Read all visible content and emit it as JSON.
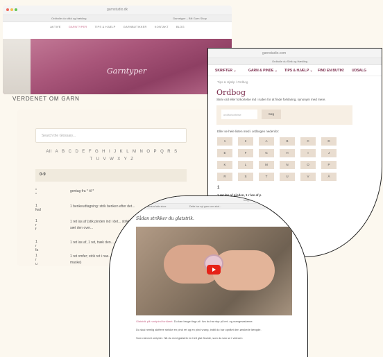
{
  "window1": {
    "url": "garnstudio.dk",
    "tabs": [
      "Ordbolle du stikk og hækling",
      "Garnstype – Blit Garn Shop"
    ],
    "nav": [
      "AKTIVE",
      "GARNTYPER",
      "TIPS & HJÆLP",
      "GARNBUTIKKER",
      "KONTAKT",
      "BLOG"
    ],
    "active_nav": "GARNTYPER",
    "hero_title": "Garntyper",
    "page_heading": "VERDENET OM GARN"
  },
  "glossary": {
    "search_placeholder": "Search the Glossary...",
    "letters_row1": [
      "All",
      "A",
      "B",
      "C",
      "D",
      "E",
      "F",
      "G",
      "H",
      "I",
      "J",
      "K",
      "L",
      "M",
      "N",
      "O",
      "P",
      "Q",
      "R",
      "S"
    ],
    "letters_row2": [
      "T",
      "U",
      "V",
      "W",
      "X",
      "Y",
      "Z"
    ],
    "section": "0-9",
    "rows": [
      {
        "term": "* *",
        "desc": "gentag fra * til *"
      },
      {
        "term": "1 fwd",
        "desc": "1 benkeudtagning: strik benken efter det..."
      },
      {
        "term": "1 r f",
        "desc": "1 ret las af (stik pinden ind i det... strikkes ret, og sæt den over..."
      },
      {
        "term": "1 r fa",
        "desc": "1 ret las af, 1 ret, træk den..."
      },
      {
        "term": "1 r u",
        "desc": "1 ret omfer; strik ret i nas... denne (= omslag + maske)"
      }
    ]
  },
  "window2": {
    "url": "garnstudio.com",
    "tab": "Ordbolle du Strik og Hækling",
    "nav": [
      "SKRIFTER ⌄",
      "GARN & PINDE ⌄",
      "TIPS & HJÆLP ⌄",
      "FIND EN BUTIK!",
      "UDSALG"
    ],
    "breadcrumb": "Tips & Hjælp  /  Ordbog",
    "title": "Ordbog",
    "lead": "Skriv ord eller forkortelse ind i ruden for at finde forklaring, synonym med mere.",
    "search_placeholder": "ord/forkortelse",
    "search_button": "Søg",
    "or_text": "Eller se hele listen med i ordbogen nedenfor:",
    "letters": [
      "1",
      "2",
      "A",
      "B",
      "C",
      "D",
      "E",
      "F",
      "G",
      "H",
      "I",
      "J",
      "K",
      "L",
      "M",
      "N",
      "O",
      "P",
      "R",
      "S",
      "T",
      "U",
      "V",
      "Å"
    ],
    "section": "1",
    "entry": "1 ret løs af pinden, 1 r løs af p"
  },
  "window3": {
    "url": "blog.sohatto.dk",
    "tabs": [
      "1.2096 – lanaza fatto store",
      "Dette har nyt garn som skal..."
    ],
    "video_title": "Sådan strikker du glatstrik.",
    "caption1_link": "Glatstrik på rundpind forklaret:",
    "caption1": " Du kan bruge ting ud i livs du har styr på ret- og vrangmaskerne.",
    "caption2": "Du skal nemlig skifteve strikke en pind ret og en pind vrang, indtil du har opnået den ønskede længde.",
    "caption3": "Som nævnet omtyder. Nå du med glatstrik en helt glat flovide, som du kan se i videoen"
  },
  "colors": {
    "accent": "#c96a8a",
    "wine": "#7a2b4b",
    "cream": "#fcf8ef",
    "youtube": "#e62117"
  }
}
